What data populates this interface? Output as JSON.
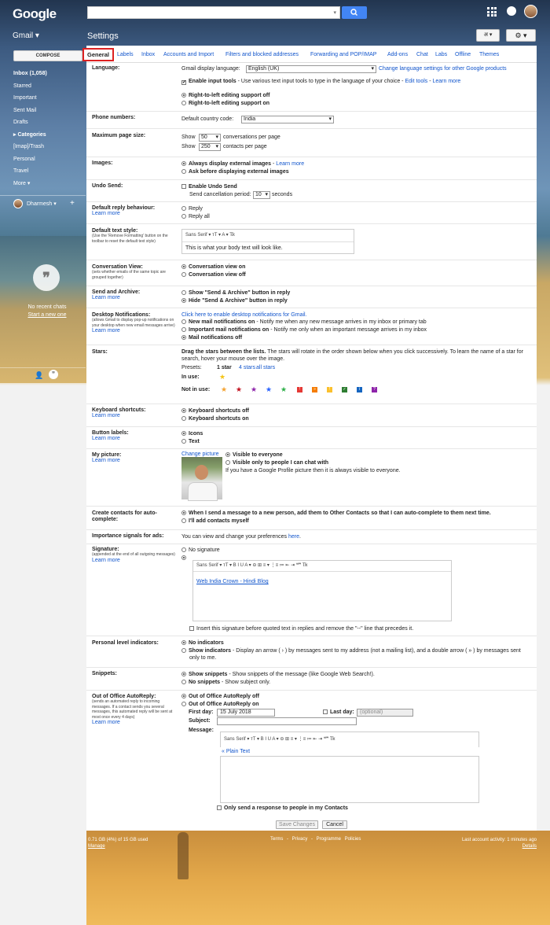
{
  "header": {
    "logo": "Google",
    "app": "Gmail ▾",
    "page_title": "Settings",
    "lang_button": "अ ▾",
    "gear_button": "⚙ ▾"
  },
  "sidebar": {
    "compose": "COMPOSE",
    "items": [
      {
        "label": "Inbox (1,058)",
        "bold": true
      },
      {
        "label": "Starred"
      },
      {
        "label": "Important"
      },
      {
        "label": "Sent Mail"
      },
      {
        "label": "Drafts"
      },
      {
        "label": "▸ Categories",
        "bold": true
      },
      {
        "label": "[Imap]/Trash"
      },
      {
        "label": "Personal"
      },
      {
        "label": "Travel"
      },
      {
        "label": "More ▾"
      }
    ],
    "user": "Dharmesh ▾",
    "add": "+",
    "no_chats": "No recent chats",
    "start_new": "Start a new one"
  },
  "tabs": [
    "General",
    "Labels",
    "Inbox",
    "Accounts and Import",
    "Filters and blocked addresses",
    "Forwarding and POP/IMAP",
    "Add-ons",
    "Chat",
    "Labs",
    "Offline",
    "Themes"
  ],
  "language": {
    "label": "Language:",
    "display_label": "Gmail display language:",
    "display_value": "English (UK)",
    "change_link": "Change language settings for other Google products",
    "enable_tools": "Enable input tools",
    "enable_tools_desc": " - Use various text input tools to type in the language of your choice - ",
    "edit_tools": "Edit tools",
    "sep": " - ",
    "learn_more": "Learn more",
    "rtl_off": "Right-to-left editing support off",
    "rtl_on": "Right-to-left editing support on"
  },
  "phone": {
    "label": "Phone numbers:",
    "country_label": "Default country code:",
    "country": "India"
  },
  "page_size": {
    "label": "Maximum page size:",
    "show": "Show",
    "conv_value": "50",
    "conv_text": "conversations per page",
    "contacts_value": "250",
    "contacts_text": "contacts per page"
  },
  "images": {
    "label": "Images:",
    "always": "Always display external images",
    "sep": " - ",
    "learn_more": "Learn more",
    "ask": "Ask before displaying external images"
  },
  "undo": {
    "label": "Undo Send:",
    "enable": "Enable Undo Send",
    "period_label": "Send cancellation period:",
    "period_value": "10",
    "seconds": "seconds"
  },
  "reply": {
    "label": "Default reply behaviour:",
    "learn_more": "Learn more",
    "reply": "Reply",
    "reply_all": "Reply all"
  },
  "text_style": {
    "label": "Default text style:",
    "sub": "(Use the 'Remove Formatting' button on the toolbar to reset the default text style)",
    "toolbar": "Sans Serif  ▾   ᴛT ▾    A ▾    T̸x",
    "preview": "This is what your body text will look like."
  },
  "conversation": {
    "label": "Conversation View:",
    "sub": "(sets whether emails of the same topic are grouped together)",
    "on": "Conversation view on",
    "off": "Conversation view off"
  },
  "send_archive": {
    "label": "Send and Archive:",
    "learn_more": "Learn more",
    "show": "Show \"Send & Archive\" button in reply",
    "hide": "Hide \"Send & Archive\" button in reply"
  },
  "desktop": {
    "label": "Desktop Notifications:",
    "sub": "(allows Gmail to display pop-up notifications on your desktop when new email messages arrive)",
    "learn_more": "Learn more",
    "enable_link": "Click here to enable desktop notifications for Gmail.",
    "new_mail": "New mail notifications on",
    "new_mail_desc": " - Notify me when any new message arrives in my inbox or primary tab",
    "important": "Important mail notifications on",
    "important_desc": " - Notify me only when an important message arrives in my inbox",
    "off": "Mail notifications off"
  },
  "stars": {
    "label": "Stars:",
    "drag": "Drag the stars between the lists.",
    "drag_desc": "  The stars will rotate in the order shown below when you click successively. To learn the name of a star for",
    "drag_desc2": "search, hover your mouse over the image.",
    "presets": "Presets:",
    "p1": "1 star",
    "p4": "4 stars",
    "pall": "all stars",
    "in_use": "In use:",
    "not_in_use": "Not in use:",
    "in_use_color": "#f5c518",
    "not_in_use_colors": [
      "#f4a332",
      "#c2121f",
      "#8e24aa",
      "#2962ff",
      "#2fb04a",
      "#e53935",
      "#f57c00",
      "#fbc02d",
      "#2e7d32",
      "#1565c0",
      "#8e24aa"
    ]
  },
  "keyboard": {
    "label": "Keyboard shortcuts:",
    "learn_more": "Learn more",
    "off": "Keyboard shortcuts off",
    "on": "Keyboard shortcuts on"
  },
  "button_labels": {
    "label": "Button labels:",
    "learn_more": "Learn more",
    "icons": "Icons",
    "text": "Text"
  },
  "picture": {
    "label": "My picture:",
    "learn_more": "Learn more",
    "change": "Change picture",
    "everyone": "Visible to everyone",
    "only": "Visible only to people I can chat with",
    "note": "If you have a Google Profile picture then it is always visible to everyone."
  },
  "contacts": {
    "label": "Create contacts for auto-complete:",
    "auto": "When I send a message to a new person, add them to Other Contacts so that I can auto-complete to them next time.",
    "manual": "I'll add contacts myself"
  },
  "importance": {
    "label": "Importance signals for ads:",
    "text": "You can view and change your preferences ",
    "here": "here",
    "dot": "."
  },
  "signature": {
    "label": "Signature:",
    "sub": "(appended at the end of all outgoing messages)",
    "learn_more": "Learn more",
    "none": "No signature",
    "toolbar": "Sans Serif  ▾   ᴛT ▾    B    I    U    A ▾    ⊖    ⊞    ≡ ▾   ⋮≡   ≔   ⇤   ⇥   ❝❞    T̸x",
    "link": "Web India Crown - Hindi Blog",
    "insert": "Insert this signature before quoted text in replies and remove the \"--\" line that precedes it."
  },
  "level": {
    "label": "Personal level indicators:",
    "none": "No indicators",
    "show": "Show indicators",
    "show_desc": " - Display an arrow ( › ) by messages sent to my address (not a mailing list), and a double arrow ( » ) by messages sent",
    "show_desc2": "only to me."
  },
  "snippets": {
    "label": "Snippets:",
    "show": "Show snippets",
    "show_desc": " - Show snippets of the message (like Google Web Search!).",
    "none": "No snippets",
    "none_desc": " - Show subject only."
  },
  "ooo": {
    "label": "Out of Office AutoReply:",
    "sub": "(sends an automated reply to incoming messages. If a contact sends you several messages, this automated reply will be sent at most once every 4 days)",
    "learn_more": "Learn more",
    "off": "Out of Office AutoReply off",
    "on": "Out of Office AutoReply on",
    "first_day": "First day:",
    "first_value": "15 July 2018",
    "last_day": "Last day:",
    "last_placeholder": "(optional)",
    "subject": "Subject:",
    "message": "Message:",
    "toolbar": "Sans Serif  ▾   ᴛT ▾    B    I    U    A ▾    ⊖    ⊞    ≡ ▾   ⋮≡   ≔   ⇤   ⇥   ❝❞    T̸x",
    "plain": "« Plain Text",
    "contacts_only": "Only send a response to people in my Contacts"
  },
  "actions": {
    "save": "Save Changes",
    "cancel": "Cancel"
  },
  "footer": {
    "usage": "0.71 GB (4%) of 15 GB used",
    "manage": "Manage",
    "links": "Terms - Privacy - Programme Policies",
    "activity": "Last account activity: 1 minutes ago",
    "details": "Details"
  }
}
